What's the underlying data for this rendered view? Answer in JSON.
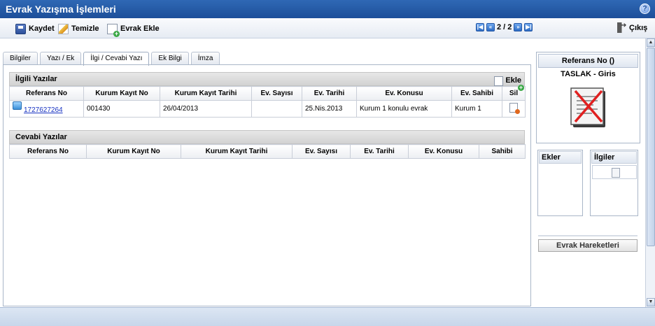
{
  "window": {
    "title": "Evrak Yazışma İşlemleri"
  },
  "toolbar": {
    "save_label": "Kaydet",
    "clear_label": "Temizle",
    "add_doc_label": "Evrak Ekle",
    "page_indicator": "2 / 2",
    "exit_label": "Çıkış"
  },
  "tabs": [
    {
      "label": "Bilgiler"
    },
    {
      "label": "Yazı / Ek"
    },
    {
      "label": "İlgi / Cevabi Yazı"
    },
    {
      "label": "Ek Bilgi"
    },
    {
      "label": "İmza"
    }
  ],
  "ilgili": {
    "title": "İlgili Yazılar",
    "add_label": "Ekle",
    "columns": [
      "Referans No",
      "Kurum Kayıt No",
      "Kurum Kayıt Tarihi",
      "Ev. Sayısı",
      "Ev. Tarihi",
      "Ev. Konusu",
      "Ev. Sahibi",
      "Sil"
    ],
    "rows": [
      {
        "ref": "1727627264",
        "kurum_kayit_no": "001430",
        "kurum_kayit_tarihi": "26/04/2013",
        "ev_sayisi": "",
        "ev_tarihi": "25.Nis.2013",
        "ev_konusu": "Kurum 1 konulu evrak",
        "ev_sahibi": "Kurum 1"
      }
    ]
  },
  "cevabi": {
    "title": "Cevabi Yazılar",
    "columns": [
      "Referans No",
      "Kurum Kayıt No",
      "Kurum Kayıt Tarihi",
      "Ev. Sayısı",
      "Ev. Tarihi",
      "Ev. Konusu",
      "Sahibi"
    ]
  },
  "side": {
    "ref_title": "Referans No ()",
    "ref_status": "TASLAK - Giris",
    "ekler_label": "Ekler",
    "ilgiler_label": "İlgiler",
    "hareket_label": "Evrak Hareketleri"
  },
  "icons": [
    "help-icon",
    "save-icon",
    "clear-icon",
    "add-document-icon",
    "first-page-icon",
    "prev-page-icon",
    "next-page-icon",
    "last-page-icon",
    "exit-icon",
    "reference-icon",
    "delete-icon",
    "document-cancelled-icon",
    "search-icon"
  ]
}
